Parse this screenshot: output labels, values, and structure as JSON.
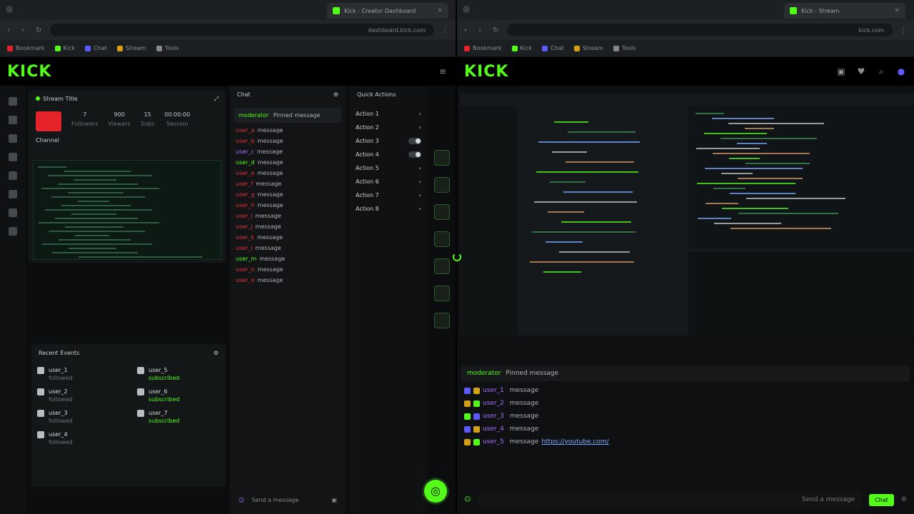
{
  "left_window": {
    "tab_title": "Kick - Creator Dashboard",
    "url": "dashboard.kick.com",
    "bookmarks": [
      "Bookmark",
      "Kick",
      "Chat",
      "Stream",
      "Tools"
    ],
    "logo": "KICK",
    "dashboard": {
      "stream_title": "Stream Title",
      "stats": [
        {
          "value": "7",
          "label": "Followers"
        },
        {
          "value": "900",
          "label": "Viewers"
        },
        {
          "value": "15",
          "label": "Subs"
        },
        {
          "value": "00:00:00",
          "label": "Session"
        }
      ],
      "channel_label": "Channel",
      "events_title": "Recent Events",
      "events_left": [
        {
          "name": "user_1",
          "sub": "followed"
        },
        {
          "name": "user_2",
          "sub": "followed"
        },
        {
          "name": "user_3",
          "sub": "followed"
        },
        {
          "name": "user_4",
          "sub": "followed"
        }
      ],
      "events_right": [
        {
          "name": "user_5",
          "sub": "subscribed"
        },
        {
          "name": "user_6",
          "sub": "subscribed"
        },
        {
          "name": "user_7",
          "sub": "subscribed"
        }
      ]
    },
    "chat": {
      "title": "Chat",
      "pinned_user": "moderator",
      "pinned_text": "Pinned message",
      "messages": [
        {
          "user": "user_a",
          "text": "message",
          "color": "r"
        },
        {
          "user": "user_b",
          "text": "message",
          "color": "r"
        },
        {
          "user": "user_c",
          "text": "message",
          "color": "p"
        },
        {
          "user": "user_d",
          "text": "message",
          "color": "g"
        },
        {
          "user": "user_e",
          "text": "message",
          "color": "r"
        },
        {
          "user": "user_f",
          "text": "message",
          "color": "r"
        },
        {
          "user": "user_g",
          "text": "message",
          "color": "r"
        },
        {
          "user": "user_h",
          "text": "message",
          "color": "r"
        },
        {
          "user": "user_i",
          "text": "message",
          "color": "r"
        },
        {
          "user": "user_j",
          "text": "message",
          "color": "r"
        },
        {
          "user": "user_k",
          "text": "message",
          "color": "r"
        },
        {
          "user": "user_l",
          "text": "message",
          "color": "r"
        },
        {
          "user": "user_m",
          "text": "message",
          "color": "g"
        },
        {
          "user": "user_n",
          "text": "message",
          "color": "r"
        },
        {
          "user": "user_o",
          "text": "message",
          "color": "r"
        }
      ],
      "input_placeholder": "Send a message"
    },
    "quick_actions": {
      "title": "Quick Actions",
      "items": [
        "Action 1",
        "Action 2",
        "Action 3",
        "Action 4",
        "Action 5",
        "Action 6",
        "Action 7",
        "Action 8"
      ]
    }
  },
  "right_window": {
    "tab_title": "Kick - Stream",
    "url": "kick.com",
    "bookmarks": [
      "Bookmark",
      "Kick",
      "Chat",
      "Stream",
      "Tools"
    ],
    "logo": "KICK",
    "chat": {
      "pinned_user": "moderator",
      "pinned_text": "Pinned message",
      "messages": [
        {
          "user": "user_1",
          "text": "message"
        },
        {
          "user": "user_2",
          "text": "message"
        },
        {
          "user": "user_3",
          "text": "message"
        },
        {
          "user": "user_4",
          "text": "message"
        },
        {
          "user": "user_5",
          "text": "message",
          "link": "https://youtube.com/"
        }
      ],
      "input_placeholder": "Send a message",
      "chat_button": "Chat"
    }
  },
  "colors": {
    "brand": "#53fc18",
    "background": "#0e1011",
    "danger": "#e5232b"
  }
}
